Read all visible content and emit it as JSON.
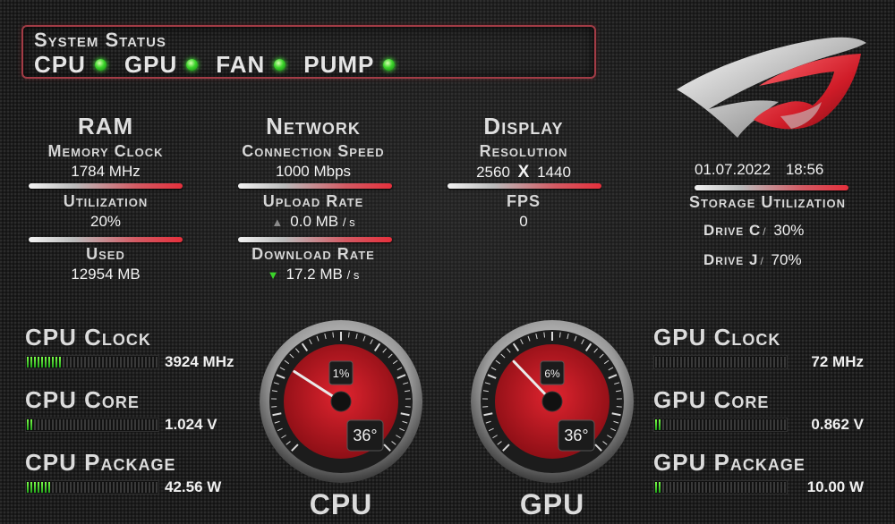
{
  "status": {
    "title": "System Status",
    "items": [
      {
        "label": "CPU",
        "state": "ok"
      },
      {
        "label": "GPU",
        "state": "ok"
      },
      {
        "label": "FAN",
        "state": "ok"
      },
      {
        "label": "PUMP",
        "state": "ok"
      }
    ],
    "led_color": "#3bd42a",
    "border_color": "#a23c46"
  },
  "ram": {
    "title": "RAM",
    "memory_clock_label": "Memory Clock",
    "memory_clock_value": "1784 MHz",
    "utilization_label": "Utilization",
    "utilization_value": "20%",
    "used_label": "Used",
    "used_value": "12954 MB"
  },
  "network": {
    "title": "Network",
    "connection_speed_label": "Connection Speed",
    "connection_speed_value": "1000 Mbps",
    "upload_label": "Upload Rate",
    "upload_value": "0.0 MB",
    "upload_unit": "/ s",
    "download_label": "Download Rate",
    "download_value": "17.2 MB",
    "download_unit": "/ s"
  },
  "display": {
    "title": "Display",
    "resolution_label": "Resolution",
    "res_w": "2560",
    "res_x": "X",
    "res_h": "1440",
    "fps_label": "FPS",
    "fps_value": "0"
  },
  "clock": {
    "date": "01.07.2022",
    "time": "18:56"
  },
  "storage": {
    "title": "Storage Utilization",
    "drives": [
      {
        "label": "Drive C",
        "sep": "/",
        "value": "30%"
      },
      {
        "label": "Drive J",
        "sep": "/",
        "value": "70%"
      }
    ]
  },
  "cpu": {
    "gauge_title": "CPU",
    "load": "1%",
    "load_fraction": 0.01,
    "temp": "36°",
    "meters": [
      {
        "label": "CPU Clock",
        "value": "3924 MHz",
        "level": 0.28
      },
      {
        "label": "CPU Core",
        "value": "1.024 V",
        "level": 0.05
      },
      {
        "label": "CPU Package",
        "value": "42.56 W",
        "level": 0.18
      }
    ]
  },
  "gpu": {
    "gauge_title": "GPU",
    "load": "6%",
    "load_fraction": 0.06,
    "temp": "36°",
    "meters": [
      {
        "label": "GPU Clock",
        "value": "72 MHz",
        "level": 0.0
      },
      {
        "label": "GPU Core",
        "value": "0.862 V",
        "level": 0.05
      },
      {
        "label": "GPU Package",
        "value": "10.00 W",
        "level": 0.05
      }
    ]
  }
}
